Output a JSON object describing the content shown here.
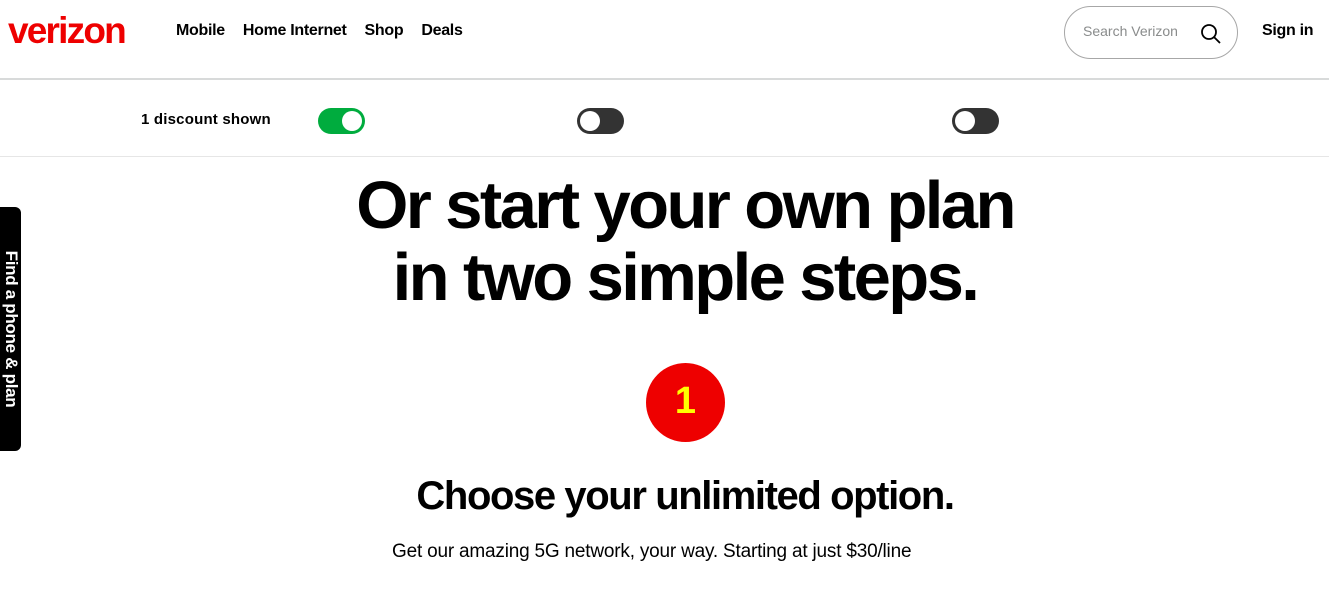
{
  "header": {
    "brand": "verizon",
    "nav": [
      "Mobile",
      "Home Internet",
      "Shop",
      "Deals"
    ],
    "search_placeholder": "Search Verizon",
    "signin_label": "Sign in"
  },
  "discount_bar": {
    "label": "1 discount shown",
    "toggles": [
      {
        "state": "on",
        "text": ""
      },
      {
        "state": "off",
        "text": ""
      },
      {
        "state": "off",
        "text": ""
      }
    ]
  },
  "side_tab": {
    "label": "Find a phone & plan"
  },
  "main": {
    "headline_line1": "Or start your own plan",
    "headline_line2": "in two simple steps.",
    "step_number": "1",
    "subhead": "Choose your unlimited option.",
    "description": "Get our amazing 5G network, your way. Starting at just $30/line"
  },
  "colors": {
    "brand_red": "#ee0000",
    "toggle_on": "#00ac3e",
    "toggle_off": "#333333",
    "step_number": "#ffff00"
  }
}
